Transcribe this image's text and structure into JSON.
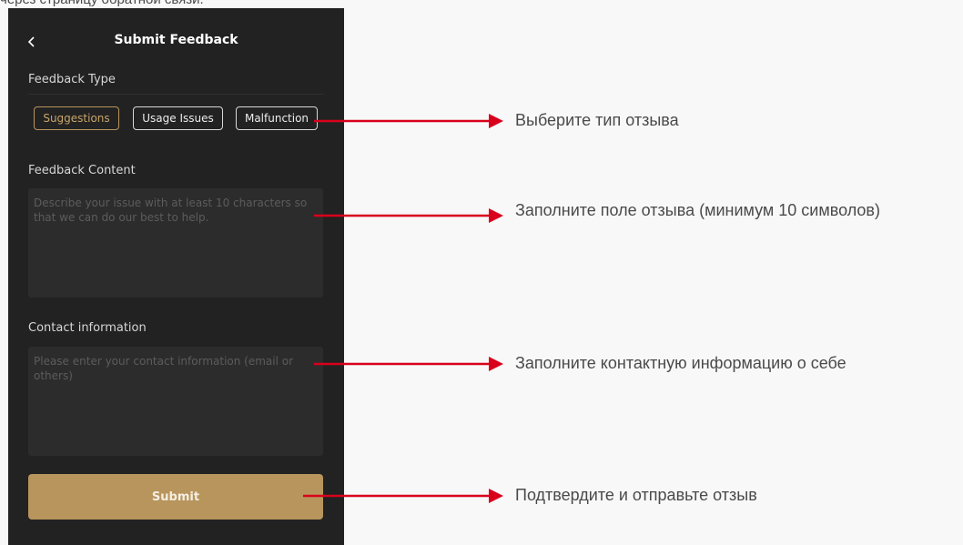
{
  "caption": "через страницу обратной связи.",
  "header": {
    "title": "Submit Feedback"
  },
  "feedback_type": {
    "label": "Feedback Type",
    "options": [
      "Suggestions",
      "Usage Issues",
      "Malfunction"
    ],
    "selected": "Suggestions"
  },
  "feedback_content": {
    "label": "Feedback Content",
    "placeholder": "Describe your issue with at least 10 characters so that we can do our best to help."
  },
  "contact": {
    "label": "Contact information",
    "placeholder": "Please enter your contact information (email or others)"
  },
  "submit": {
    "label": "Submit"
  },
  "annotations": [
    "Выберите тип отзыва",
    "Заполните поле отзыва (минимум 10 символов)",
    "Заполните контактную информацию о себе",
    "Подтвердите и отправьте отзыв"
  ],
  "colors": {
    "accent": "#b8955c",
    "arrow": "#d9001b",
    "panel": "#222222"
  }
}
